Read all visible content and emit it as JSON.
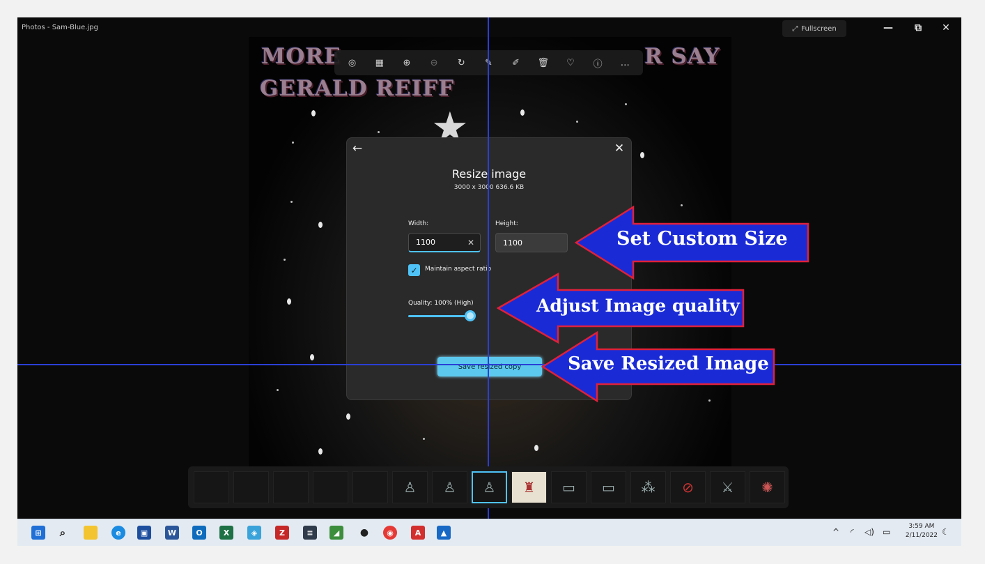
{
  "window": {
    "title": "Photos - Sam-Blue.jpg",
    "fullscreen_label": "Fullscreen",
    "minimize_icon": "minimize-icon",
    "restore_icon": "restore-icon",
    "close_icon": "close-icon"
  },
  "photo": {
    "line1_left": "MORE",
    "line1_right": "R SAY",
    "line2": "GERALD REIFF"
  },
  "toolbar": {
    "icons": [
      "enhance-icon",
      "view-all-icon",
      "zoom-in-icon",
      "zoom-out-icon",
      "rotate-icon",
      "edit-icon",
      "markup-icon",
      "delete-icon",
      "favorite-icon",
      "info-icon",
      "more-icon"
    ]
  },
  "dialog": {
    "title": "Resize image",
    "subtitle": "3000 x 3000   636.6 KB",
    "width_label": "Width:",
    "width_value": "1100",
    "height_label": "Height:",
    "height_value": "1100",
    "maintain_aspect_label": "Maintain aspect ratio",
    "maintain_aspect_checked": true,
    "quality_label": "Quality: 100% (High)",
    "quality_value": 1.0,
    "save_label": "Save resized copy"
  },
  "annotations": [
    {
      "text": "Set Custom Size"
    },
    {
      "text": "Adjust Image quality"
    },
    {
      "text": "Save Resized Image"
    }
  ],
  "colors": {
    "accent": "#4fc3f7",
    "arrow_fill": "#1a2bd6",
    "arrow_border": "#e0203a",
    "guide_line": "#2a3fd6"
  },
  "taskbar": {
    "time": "3:59 AM",
    "date": "2/11/2022"
  }
}
